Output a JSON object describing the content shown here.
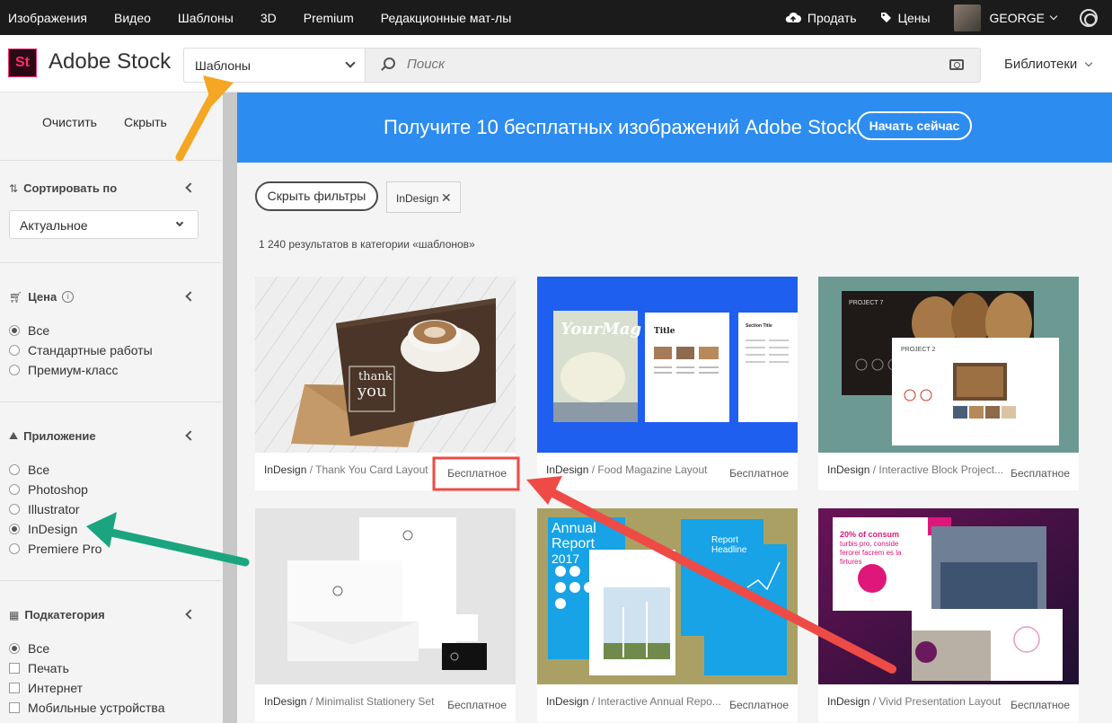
{
  "topnav": {
    "left": [
      "Изображения",
      "Видео",
      "Шаблоны",
      "3D",
      "Premium",
      "Редакционные мат-лы"
    ],
    "sell": "Продать",
    "prices": "Цены",
    "user": "GEORGE"
  },
  "header": {
    "logo": "St",
    "brand": "Adobe Stock",
    "category": "Шаблоны",
    "search_placeholder": "Поиск",
    "libraries": "Библиотеки"
  },
  "sidebar": {
    "clear": "Очистить",
    "hide": "Скрыть",
    "sort_title": "Сортировать по",
    "sort_value": "Актуальное",
    "price_title": "Цена",
    "price_options": [
      "Все",
      "Стандартные работы",
      "Премиум-класс"
    ],
    "app_title": "Приложение",
    "app_options": [
      "Все",
      "Photoshop",
      "Illustrator",
      "InDesign",
      "Premiere Pro"
    ],
    "subcat_title": "Подкатегория",
    "subcat_options": [
      "Все",
      "Печать",
      "Интернет",
      "Мобильные устройства"
    ]
  },
  "banner": {
    "text": "Получите 10 бесплатных изображений Adobe Stock.",
    "button": "Начать сейчас"
  },
  "filters": {
    "hide_button": "Скрыть фильтры",
    "chip": "InDesign",
    "results": "1 240 результатов в категории «шаблонов»"
  },
  "cards": [
    {
      "app": "InDesign",
      "title": "/ Thank You Card Layout",
      "badge": "Бесплатное"
    },
    {
      "app": "InDesign",
      "title": "/ Food Magazine Layout",
      "badge": "Бесплатное"
    },
    {
      "app": "InDesign",
      "title": "/ Interactive Block Project...",
      "badge": "Бесплатное"
    },
    {
      "app": "InDesign",
      "title": "/ Minimalist Stationery Set",
      "badge": "Бесплатное"
    },
    {
      "app": "InDesign",
      "title": "/ Interactive Annual Repo...",
      "badge": "Бесплатное"
    },
    {
      "app": "InDesign",
      "title": "/ Vivid Presentation Layout",
      "badge": "Бесплатное"
    }
  ],
  "thumb_text": {
    "thank": "thank",
    "you": "you",
    "yourmag": "YourMag",
    "mag_title": "Title",
    "section_title": "Section Title",
    "project7": "PROJECT 7",
    "project2": "PROJECT 2",
    "annual": "Annual",
    "report": "Report",
    "year": "2017",
    "report_headline_1": "Report",
    "report_headline_2": "Headline",
    "consum_1": "20% of consum",
    "consum_2": "turbis pro, conside",
    "consum_3": "ferorei facrem es la",
    "consum_4": "firtures"
  },
  "colors": {
    "topnav": "#1b1b1b",
    "banner": "#2d8cef",
    "logo_accent": "#ff2d6f",
    "arrow_orange": "#f5a623",
    "arrow_green": "#1aa57e",
    "arrow_red": "#ef4b46"
  }
}
